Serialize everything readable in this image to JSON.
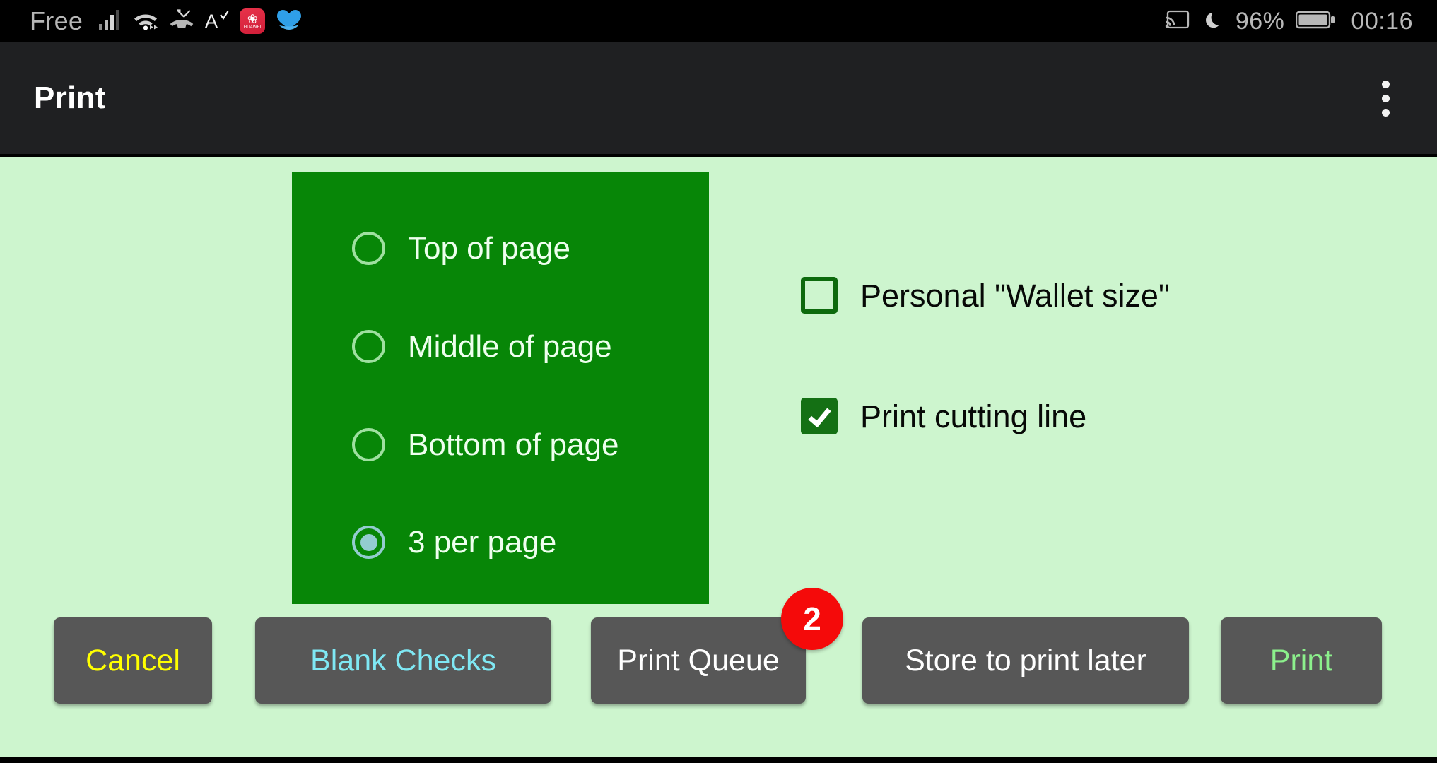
{
  "status_bar": {
    "carrier": "Free",
    "battery_percent": "96%",
    "clock": "00:16",
    "icons": [
      "signal-bars-icon",
      "wifi-icon",
      "missed-call-icon",
      "accessibility-a-icon",
      "huawei-app-icon",
      "blue-heart-icon",
      "cast-icon",
      "do-not-disturb-moon-icon",
      "battery-icon"
    ],
    "huawei_badge": {
      "mark": "❀",
      "text": "HUAWEI"
    }
  },
  "app_bar": {
    "title": "Print",
    "overflow_menu": "overflow-menu-icon"
  },
  "placement": {
    "options": [
      {
        "label": "Top of page",
        "selected": false
      },
      {
        "label": "Middle of page",
        "selected": false
      },
      {
        "label": "Bottom of page",
        "selected": false
      },
      {
        "label": "3 per page",
        "selected": true
      }
    ]
  },
  "options": {
    "wallet_size": {
      "label": "Personal \"Wallet size\"",
      "checked": false
    },
    "cutting_line": {
      "label": "Print cutting line",
      "checked": true
    }
  },
  "buttons": {
    "cancel": "Cancel",
    "blank_checks": "Blank Checks",
    "print_queue": "Print Queue",
    "store_later": "Store to print later",
    "print": "Print"
  },
  "badges": {
    "print_queue_count": "2"
  },
  "colors": {
    "content_background": "#cdf5ce",
    "panel_green": "#078607",
    "app_bar": "#1f2022",
    "button_gray": "#575757",
    "badge_red": "#f50a0a",
    "cancel_text": "#ffff00",
    "blank_checks_text": "#7fe8f4",
    "print_text": "#8cf08c",
    "checkbox_green": "#147014",
    "radio_selected": "#93ccd0"
  }
}
